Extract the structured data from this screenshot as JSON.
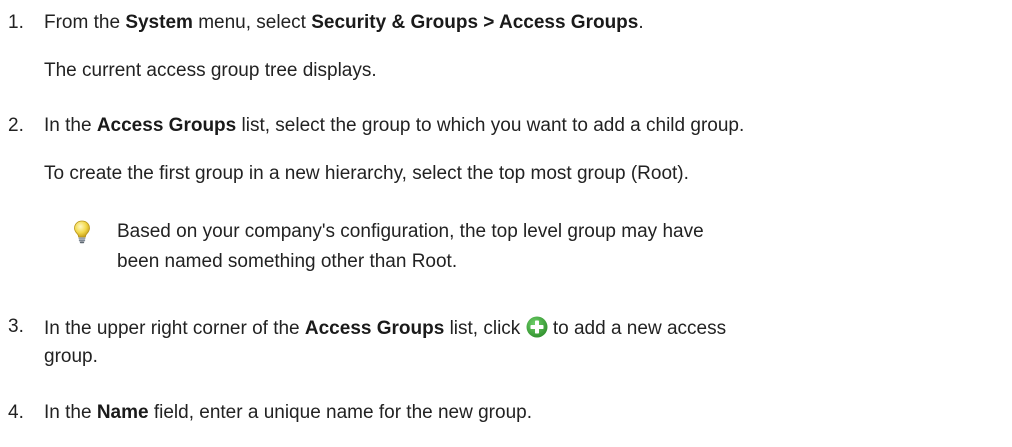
{
  "steps": [
    {
      "number": "1.",
      "line": {
        "t1": "From the ",
        "b1": "System",
        "t2": " menu, select ",
        "b2": "Security & Groups > Access Groups",
        "t3": "."
      },
      "result": "The current access group tree displays."
    },
    {
      "number": "2.",
      "line": {
        "t1": "In the ",
        "b1": "Access Groups",
        "t2": " list, select the group to which you want to add a child group."
      },
      "note": "To create the first group in a new hierarchy, select the top most group (Root).",
      "tip": {
        "icon": "lightbulb-icon",
        "line1": "Based on your company's configuration, the top level group may have",
        "line2": "been named something other than Root."
      }
    },
    {
      "number": "3.",
      "line": {
        "t1": "In the upper right corner of the ",
        "b1": "Access Groups",
        "t2": " list, click ",
        "icon": "add-icon",
        "t3": " to add a new access"
      },
      "line2": "group."
    },
    {
      "number": "4.",
      "line": {
        "t1": "In the ",
        "b1": "Name",
        "t2": " field, enter a unique name for the new group."
      }
    }
  ],
  "colors": {
    "text": "#222222",
    "add_icon_green": "#3aa035",
    "lightbulb_yellow": "#f2d84a"
  }
}
